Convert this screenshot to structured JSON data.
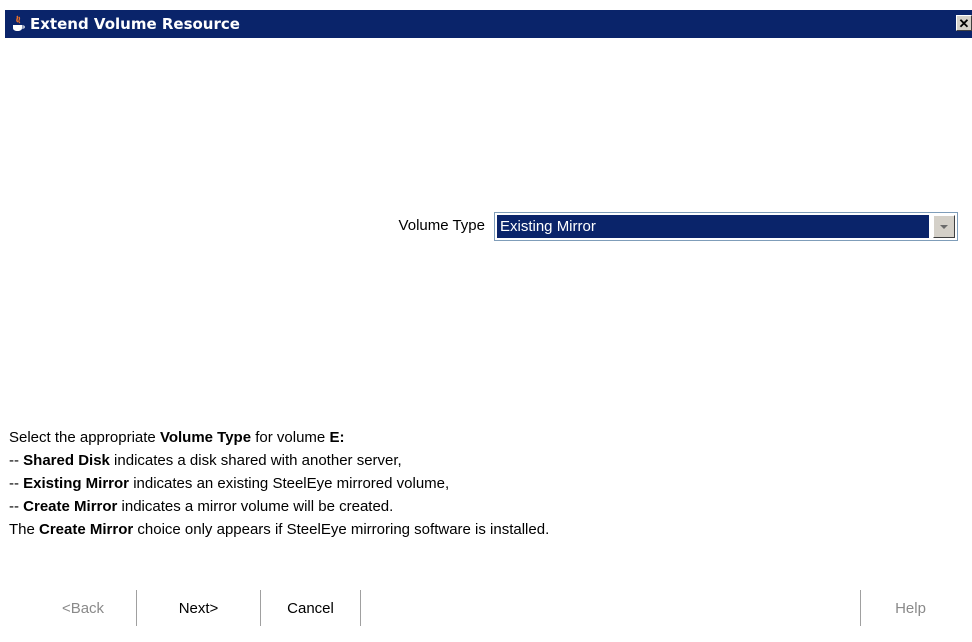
{
  "window": {
    "title": "Extend Volume Resource",
    "close_label": "✕"
  },
  "volume_type": {
    "label": "Volume Type",
    "selected": "Existing Mirror"
  },
  "description": {
    "line1_pre": "Select the appropriate ",
    "line1_bold": "Volume Type",
    "line1_mid": " for volume ",
    "line1_bold2": "E:",
    "line1_post": ":",
    "line2_pre": "-- ",
    "line2_bold": "Shared Disk",
    "line2_post": " indicates a disk shared with another server,",
    "line3_pre": "-- ",
    "line3_bold": "Existing Mirror",
    "line3_post": " indicates an existing SteelEye mirrored volume,",
    "line4_pre": "-- ",
    "line4_bold": "Create Mirror",
    "line4_post": " indicates a mirror volume will be created.",
    "line5_pre": "The ",
    "line5_bold": "Create Mirror",
    "line5_post": " choice only appears if SteelEye mirroring software is installed."
  },
  "buttons": {
    "back": "<Back",
    "next": "Next>",
    "cancel": "Cancel",
    "help": "Help"
  },
  "colors": {
    "titlebar": "#0a246a",
    "selection": "#0a246a"
  }
}
